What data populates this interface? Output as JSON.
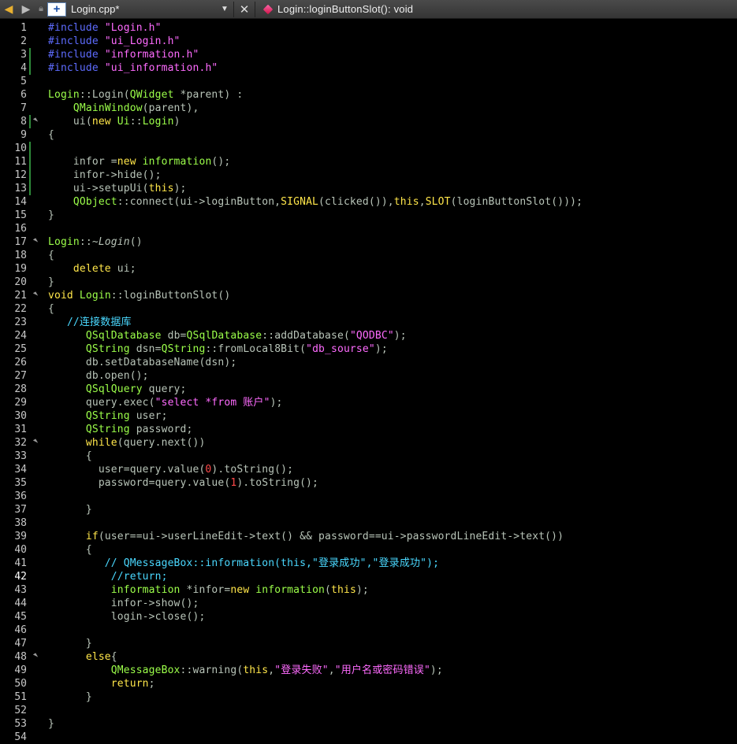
{
  "toolbar": {
    "back_icon": "arrow-left-icon",
    "forward_icon": "arrow-right-icon",
    "file_icon_glyph": "+",
    "file_name": "Login.cpp*",
    "dropdown_glyph": "▼",
    "close_glyph": "✕",
    "function_name": "Login::loginButtonSlot(): void"
  },
  "current_line": 42,
  "modified_lines": [
    3,
    4,
    8,
    10,
    11,
    12,
    13
  ],
  "fold_lines": [
    8,
    17,
    21,
    32,
    48
  ],
  "lines": [
    {
      "n": "1",
      "tokens": [
        {
          "c": "pp",
          "t": "#include"
        },
        {
          "c": "op",
          "t": " "
        },
        {
          "c": "str",
          "t": "\"Login.h\""
        }
      ]
    },
    {
      "n": "2",
      "tokens": [
        {
          "c": "pp",
          "t": "#include"
        },
        {
          "c": "op",
          "t": " "
        },
        {
          "c": "str",
          "t": "\"ui_Login.h\""
        }
      ]
    },
    {
      "n": "3",
      "tokens": [
        {
          "c": "pp",
          "t": "#include"
        },
        {
          "c": "op",
          "t": " "
        },
        {
          "c": "str",
          "t": "\"information.h\""
        }
      ]
    },
    {
      "n": "4",
      "tokens": [
        {
          "c": "pp",
          "t": "#include"
        },
        {
          "c": "op",
          "t": " "
        },
        {
          "c": "str",
          "t": "\"ui_information.h\""
        }
      ]
    },
    {
      "n": "5",
      "tokens": []
    },
    {
      "n": "6",
      "tokens": [
        {
          "c": "type",
          "t": "Login"
        },
        {
          "c": "op",
          "t": "::Login("
        },
        {
          "c": "type",
          "t": "QWidget"
        },
        {
          "c": "op",
          "t": " *parent) :"
        }
      ]
    },
    {
      "n": "7",
      "tokens": [
        {
          "c": "op",
          "t": "    "
        },
        {
          "c": "type",
          "t": "QMainWindow"
        },
        {
          "c": "op",
          "t": "(parent),"
        }
      ]
    },
    {
      "n": "8",
      "tokens": [
        {
          "c": "op",
          "t": "    ui("
        },
        {
          "c": "kw",
          "t": "new"
        },
        {
          "c": "op",
          "t": " "
        },
        {
          "c": "type",
          "t": "Ui"
        },
        {
          "c": "op",
          "t": "::"
        },
        {
          "c": "type",
          "t": "Login"
        },
        {
          "c": "op",
          "t": ")"
        }
      ]
    },
    {
      "n": "9",
      "tokens": [
        {
          "c": "op",
          "t": "{"
        }
      ]
    },
    {
      "n": "10",
      "tokens": []
    },
    {
      "n": "11",
      "tokens": [
        {
          "c": "op",
          "t": "    infor ="
        },
        {
          "c": "kw",
          "t": "new"
        },
        {
          "c": "op",
          "t": " "
        },
        {
          "c": "type",
          "t": "information"
        },
        {
          "c": "op",
          "t": "();"
        }
      ]
    },
    {
      "n": "12",
      "tokens": [
        {
          "c": "op",
          "t": "    infor->hide();"
        }
      ]
    },
    {
      "n": "13",
      "tokens": [
        {
          "c": "op",
          "t": "    ui->setupUi("
        },
        {
          "c": "kw",
          "t": "this"
        },
        {
          "c": "op",
          "t": ");"
        }
      ]
    },
    {
      "n": "14",
      "tokens": [
        {
          "c": "op",
          "t": "    "
        },
        {
          "c": "type",
          "t": "QObject"
        },
        {
          "c": "op",
          "t": "::connect(ui->loginButton,"
        },
        {
          "c": "kw",
          "t": "SIGNAL"
        },
        {
          "c": "op",
          "t": "(clicked()),"
        },
        {
          "c": "kw",
          "t": "this"
        },
        {
          "c": "op",
          "t": ","
        },
        {
          "c": "kw",
          "t": "SLOT"
        },
        {
          "c": "op",
          "t": "(loginButtonSlot()));"
        }
      ]
    },
    {
      "n": "15",
      "tokens": [
        {
          "c": "op",
          "t": "}"
        }
      ]
    },
    {
      "n": "16",
      "tokens": []
    },
    {
      "n": "17",
      "tokens": [
        {
          "c": "type",
          "t": "Login"
        },
        {
          "c": "op",
          "t": "::~"
        },
        {
          "c": "ital",
          "t": "Login"
        },
        {
          "c": "op",
          "t": "()"
        }
      ]
    },
    {
      "n": "18",
      "tokens": [
        {
          "c": "op",
          "t": "{"
        }
      ]
    },
    {
      "n": "19",
      "tokens": [
        {
          "c": "op",
          "t": "    "
        },
        {
          "c": "kw",
          "t": "delete"
        },
        {
          "c": "op",
          "t": " ui;"
        }
      ]
    },
    {
      "n": "20",
      "tokens": [
        {
          "c": "op",
          "t": "}"
        }
      ]
    },
    {
      "n": "21",
      "tokens": [
        {
          "c": "kw",
          "t": "void"
        },
        {
          "c": "op",
          "t": " "
        },
        {
          "c": "type",
          "t": "Login"
        },
        {
          "c": "op",
          "t": "::loginButtonSlot()"
        }
      ]
    },
    {
      "n": "22",
      "tokens": [
        {
          "c": "op",
          "t": "{"
        }
      ]
    },
    {
      "n": "23",
      "tokens": [
        {
          "c": "op",
          "t": "   "
        },
        {
          "c": "com",
          "t": "//连接数据库"
        }
      ]
    },
    {
      "n": "24",
      "tokens": [
        {
          "c": "op",
          "t": "      "
        },
        {
          "c": "type",
          "t": "QSqlDatabase"
        },
        {
          "c": "op",
          "t": " db="
        },
        {
          "c": "type",
          "t": "QSqlDatabase"
        },
        {
          "c": "op",
          "t": "::addDatabase("
        },
        {
          "c": "str",
          "t": "\"QODBC\""
        },
        {
          "c": "op",
          "t": ");"
        }
      ]
    },
    {
      "n": "25",
      "tokens": [
        {
          "c": "op",
          "t": "      "
        },
        {
          "c": "type",
          "t": "QString"
        },
        {
          "c": "op",
          "t": " dsn="
        },
        {
          "c": "type",
          "t": "QString"
        },
        {
          "c": "op",
          "t": "::fromLocal8Bit("
        },
        {
          "c": "str",
          "t": "\"db_sourse\""
        },
        {
          "c": "op",
          "t": ");"
        }
      ]
    },
    {
      "n": "26",
      "tokens": [
        {
          "c": "op",
          "t": "      db.setDatabaseName(dsn);"
        }
      ]
    },
    {
      "n": "27",
      "tokens": [
        {
          "c": "op",
          "t": "      db.open();"
        }
      ]
    },
    {
      "n": "28",
      "tokens": [
        {
          "c": "op",
          "t": "      "
        },
        {
          "c": "type",
          "t": "QSqlQuery"
        },
        {
          "c": "op",
          "t": " query;"
        }
      ]
    },
    {
      "n": "29",
      "tokens": [
        {
          "c": "op",
          "t": "      query.exec("
        },
        {
          "c": "str",
          "t": "\"select *from 账户\""
        },
        {
          "c": "op",
          "t": ");"
        }
      ]
    },
    {
      "n": "30",
      "tokens": [
        {
          "c": "op",
          "t": "      "
        },
        {
          "c": "type",
          "t": "QString"
        },
        {
          "c": "op",
          "t": " user;"
        }
      ]
    },
    {
      "n": "31",
      "tokens": [
        {
          "c": "op",
          "t": "      "
        },
        {
          "c": "type",
          "t": "QString"
        },
        {
          "c": "op",
          "t": " password;"
        }
      ]
    },
    {
      "n": "32",
      "tokens": [
        {
          "c": "op",
          "t": "      "
        },
        {
          "c": "kw",
          "t": "while"
        },
        {
          "c": "op",
          "t": "(query.next())"
        }
      ]
    },
    {
      "n": "33",
      "tokens": [
        {
          "c": "op",
          "t": "      {"
        }
      ]
    },
    {
      "n": "34",
      "tokens": [
        {
          "c": "op",
          "t": "        user=query.value("
        },
        {
          "c": "num",
          "t": "0"
        },
        {
          "c": "op",
          "t": ").toString();"
        }
      ]
    },
    {
      "n": "35",
      "tokens": [
        {
          "c": "op",
          "t": "        password=query.value("
        },
        {
          "c": "num",
          "t": "1"
        },
        {
          "c": "op",
          "t": ").toString();"
        }
      ]
    },
    {
      "n": "36",
      "tokens": []
    },
    {
      "n": "37",
      "tokens": [
        {
          "c": "op",
          "t": "      }"
        }
      ]
    },
    {
      "n": "38",
      "tokens": []
    },
    {
      "n": "39",
      "tokens": [
        {
          "c": "op",
          "t": "      "
        },
        {
          "c": "kw",
          "t": "if"
        },
        {
          "c": "op",
          "t": "(user==ui->userLineEdit->text() && password==ui->passwordLineEdit->text())"
        }
      ]
    },
    {
      "n": "40",
      "tokens": [
        {
          "c": "op",
          "t": "      {"
        }
      ]
    },
    {
      "n": "41",
      "tokens": [
        {
          "c": "op",
          "t": "         "
        },
        {
          "c": "com",
          "t": "// QMessageBox::information(this,\"登录成功\",\"登录成功\");"
        }
      ]
    },
    {
      "n": "42",
      "tokens": [
        {
          "c": "op",
          "t": "          "
        },
        {
          "c": "com",
          "t": "//return;"
        }
      ]
    },
    {
      "n": "43",
      "tokens": [
        {
          "c": "op",
          "t": "          "
        },
        {
          "c": "type",
          "t": "information"
        },
        {
          "c": "op",
          "t": " *infor="
        },
        {
          "c": "kw",
          "t": "new"
        },
        {
          "c": "op",
          "t": " "
        },
        {
          "c": "type",
          "t": "information"
        },
        {
          "c": "op",
          "t": "("
        },
        {
          "c": "kw",
          "t": "this"
        },
        {
          "c": "op",
          "t": ");"
        }
      ]
    },
    {
      "n": "44",
      "tokens": [
        {
          "c": "op",
          "t": "          infor->show();"
        }
      ]
    },
    {
      "n": "45",
      "tokens": [
        {
          "c": "op",
          "t": "          login->close();"
        }
      ]
    },
    {
      "n": "46",
      "tokens": []
    },
    {
      "n": "47",
      "tokens": [
        {
          "c": "op",
          "t": "      }"
        }
      ]
    },
    {
      "n": "48",
      "tokens": [
        {
          "c": "op",
          "t": "      "
        },
        {
          "c": "kw",
          "t": "else"
        },
        {
          "c": "op",
          "t": "{"
        }
      ]
    },
    {
      "n": "49",
      "tokens": [
        {
          "c": "op",
          "t": "          "
        },
        {
          "c": "type",
          "t": "QMessageBox"
        },
        {
          "c": "op",
          "t": "::warning("
        },
        {
          "c": "kw",
          "t": "this"
        },
        {
          "c": "op",
          "t": ","
        },
        {
          "c": "str",
          "t": "\"登录失败\""
        },
        {
          "c": "op",
          "t": ","
        },
        {
          "c": "str",
          "t": "\"用户名或密码错误\""
        },
        {
          "c": "op",
          "t": ");"
        }
      ]
    },
    {
      "n": "50",
      "tokens": [
        {
          "c": "op",
          "t": "          "
        },
        {
          "c": "kw",
          "t": "return"
        },
        {
          "c": "op",
          "t": ";"
        }
      ]
    },
    {
      "n": "51",
      "tokens": [
        {
          "c": "op",
          "t": "      }"
        }
      ]
    },
    {
      "n": "52",
      "tokens": []
    },
    {
      "n": "53",
      "tokens": [
        {
          "c": "op",
          "t": "}"
        }
      ]
    },
    {
      "n": "54",
      "tokens": []
    }
  ]
}
